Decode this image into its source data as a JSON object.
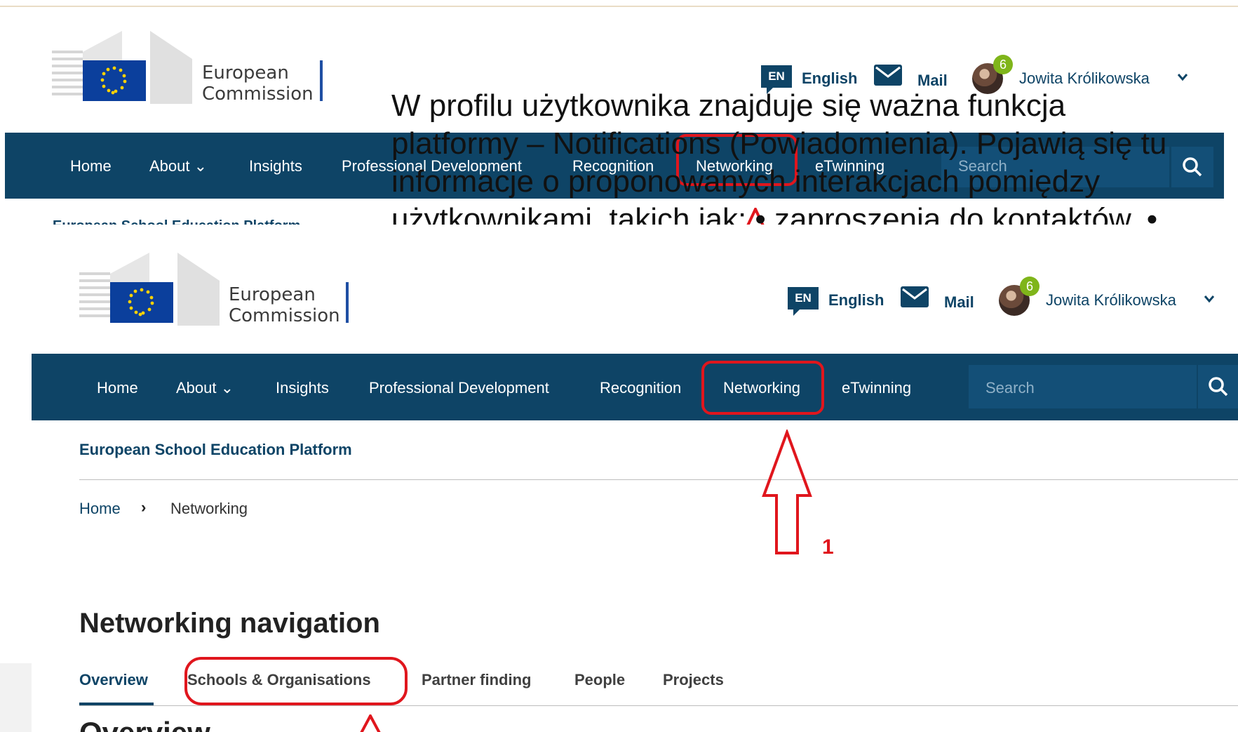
{
  "brand": {
    "line1": "European",
    "line2": "Commission"
  },
  "utilities": {
    "lang_code": "EN",
    "lang_label": "English",
    "mail_label": "Mail",
    "notification_count": "6",
    "user_name": "Jowita Królikowska"
  },
  "nav": {
    "items": [
      "Home",
      "About",
      "Insights",
      "Professional Development",
      "Recognition",
      "Networking",
      "eTwinning"
    ],
    "search_placeholder": "Search"
  },
  "overlay": {
    "lines": [
      "W profilu użytkownika znajduje się ważna funkcja",
      "platformy – Notifications (Powiadomienia). Pojawią się tu",
      "informacje o proponowanych interakcjach pomiędzy",
      "użytkownikami, takich jak: • zaproszenia do kontaktów, •"
    ]
  },
  "page": {
    "platform_title": "European School Education Platform",
    "breadcrumb": {
      "home": "Home",
      "separator": "›",
      "current": "Networking"
    },
    "section_heading": "Networking navigation",
    "tabs": [
      "Overview",
      "Schools & Organisations",
      "Partner finding",
      "People",
      "Projects"
    ],
    "active_tab": "Overview",
    "overview_heading": "Overview"
  },
  "annotations": {
    "step_1": "1"
  },
  "colors": {
    "navy": "#0e4466",
    "red": "#e0161d",
    "badge_green": "#7fb51a"
  }
}
